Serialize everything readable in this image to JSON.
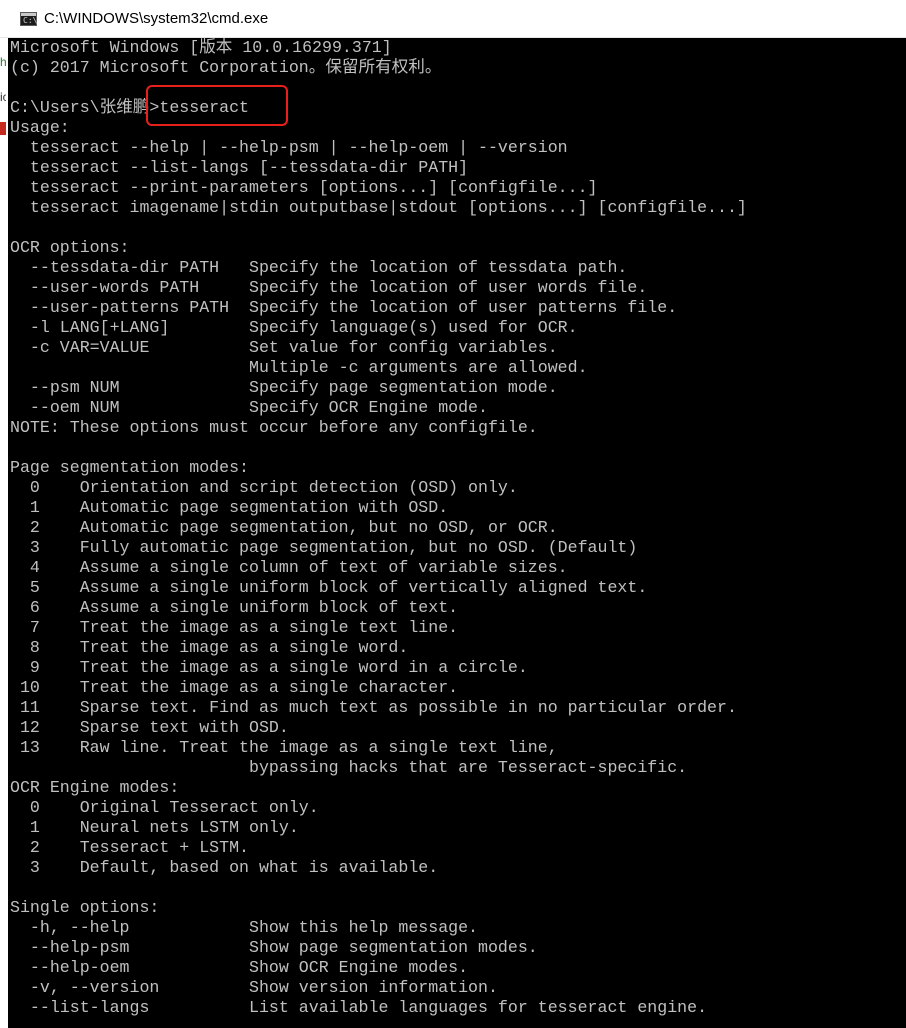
{
  "window": {
    "title": "C:\\WINDOWS\\system32\\cmd.exe",
    "icon": "cmd-icon",
    "icon_prompt": "C:\\",
    "background_color": "#000000",
    "text_color": "#c0c0c0"
  },
  "console": {
    "lines": [
      "Microsoft Windows [版本 10.0.16299.371]",
      "(c) 2017 Microsoft Corporation。保留所有权利。",
      "",
      "C:\\Users\\张维鹏>tesseract",
      "Usage:",
      "  tesseract --help | --help-psm | --help-oem | --version",
      "  tesseract --list-langs [--tessdata-dir PATH]",
      "  tesseract --print-parameters [options...] [configfile...]",
      "  tesseract imagename|stdin outputbase|stdout [options...] [configfile...]",
      "",
      "OCR options:",
      "  --tessdata-dir PATH   Specify the location of tessdata path.",
      "  --user-words PATH     Specify the location of user words file.",
      "  --user-patterns PATH  Specify the location of user patterns file.",
      "  -l LANG[+LANG]        Specify language(s) used for OCR.",
      "  -c VAR=VALUE          Set value for config variables.",
      "                        Multiple -c arguments are allowed.",
      "  --psm NUM             Specify page segmentation mode.",
      "  --oem NUM             Specify OCR Engine mode.",
      "NOTE: These options must occur before any configfile.",
      "",
      "Page segmentation modes:",
      "  0    Orientation and script detection (OSD) only.",
      "  1    Automatic page segmentation with OSD.",
      "  2    Automatic page segmentation, but no OSD, or OCR.",
      "  3    Fully automatic page segmentation, but no OSD. (Default)",
      "  4    Assume a single column of text of variable sizes.",
      "  5    Assume a single uniform block of vertically aligned text.",
      "  6    Assume a single uniform block of text.",
      "  7    Treat the image as a single text line.",
      "  8    Treat the image as a single word.",
      "  9    Treat the image as a single word in a circle.",
      " 10    Treat the image as a single character.",
      " 11    Sparse text. Find as much text as possible in no particular order.",
      " 12    Sparse text with OSD.",
      " 13    Raw line. Treat the image as a single text line,",
      "                        bypassing hacks that are Tesseract-specific.",
      "OCR Engine modes:",
      "  0    Original Tesseract only.",
      "  1    Neural nets LSTM only.",
      "  2    Tesseract + LSTM.",
      "  3    Default, based on what is available.",
      "",
      "Single options:",
      "  -h, --help            Show this help message.",
      "  --help-psm            Show page segmentation modes.",
      "  --help-oem            Show OCR Engine modes.",
      "  -v, --version         Show version information.",
      "  --list-langs          List available languages for tesseract engine."
    ]
  },
  "annotation": {
    "highlight_color": "#e8201c"
  },
  "background_window": {
    "markers": [
      {
        "text": "h",
        "color": "#2e7d32"
      },
      {
        "text": "ic",
        "color": "#333333"
      },
      {
        "text": "",
        "color": "#c42b1c"
      },
      {
        "text": "",
        "color": "#c42b1c"
      }
    ]
  }
}
